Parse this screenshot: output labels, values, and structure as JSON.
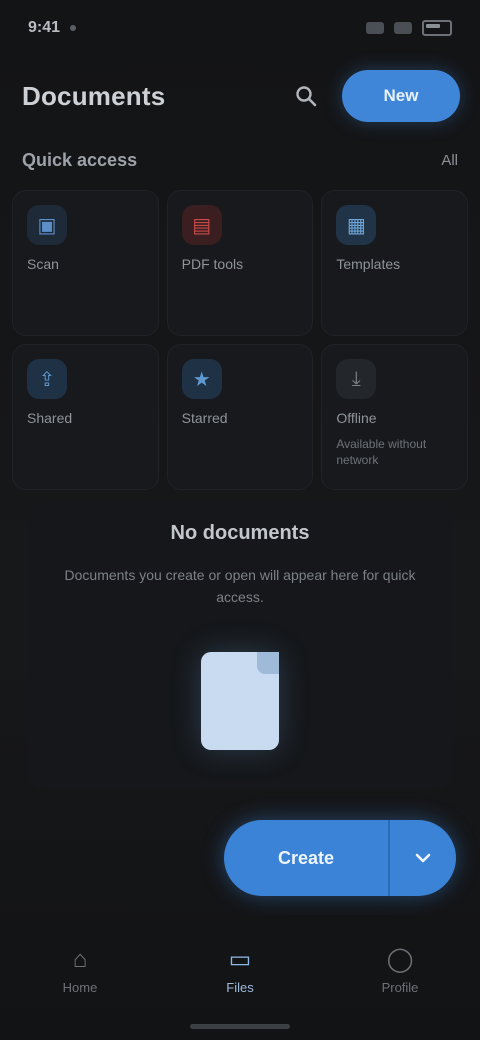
{
  "status_bar": {
    "time": "9:41"
  },
  "header": {
    "title": "Documents",
    "search_icon": "search-icon",
    "primary_action_label": "New"
  },
  "section": {
    "title": "Quick access",
    "link": "All"
  },
  "tiles": [
    {
      "label": "Scan",
      "sub": "",
      "icon": "scan-icon",
      "color": "#5c8fc8",
      "glyph": "▣"
    },
    {
      "label": "PDF tools",
      "sub": "",
      "icon": "pdf-icon",
      "color": "#c54b4b",
      "glyph": "▤"
    },
    {
      "label": "Templates",
      "sub": "",
      "icon": "template-icon",
      "color": "#6ea6d8",
      "glyph": "▦"
    },
    {
      "label": "Shared",
      "sub": "",
      "icon": "share-icon",
      "color": "#5d98cf",
      "glyph": "⇪"
    },
    {
      "label": "Starred",
      "sub": "",
      "icon": "star-icon",
      "color": "#5d98cf",
      "glyph": "★"
    },
    {
      "label": "Offline",
      "sub": "Available without network",
      "icon": "download-icon",
      "color": "#7f848a",
      "glyph": "⤓"
    }
  ],
  "empty_state": {
    "title": "No documents",
    "description": "Documents you create or open will appear here for quick access."
  },
  "fab": {
    "label": "Create",
    "aux_icon": "chevron-down-icon"
  },
  "bottom_nav": [
    {
      "label": "Home",
      "icon": "home-icon",
      "glyph": "⌂",
      "active": false
    },
    {
      "label": "Files",
      "icon": "folder-icon",
      "glyph": "▭",
      "active": true
    },
    {
      "label": "Profile",
      "icon": "person-icon",
      "glyph": "◯",
      "active": false
    }
  ]
}
